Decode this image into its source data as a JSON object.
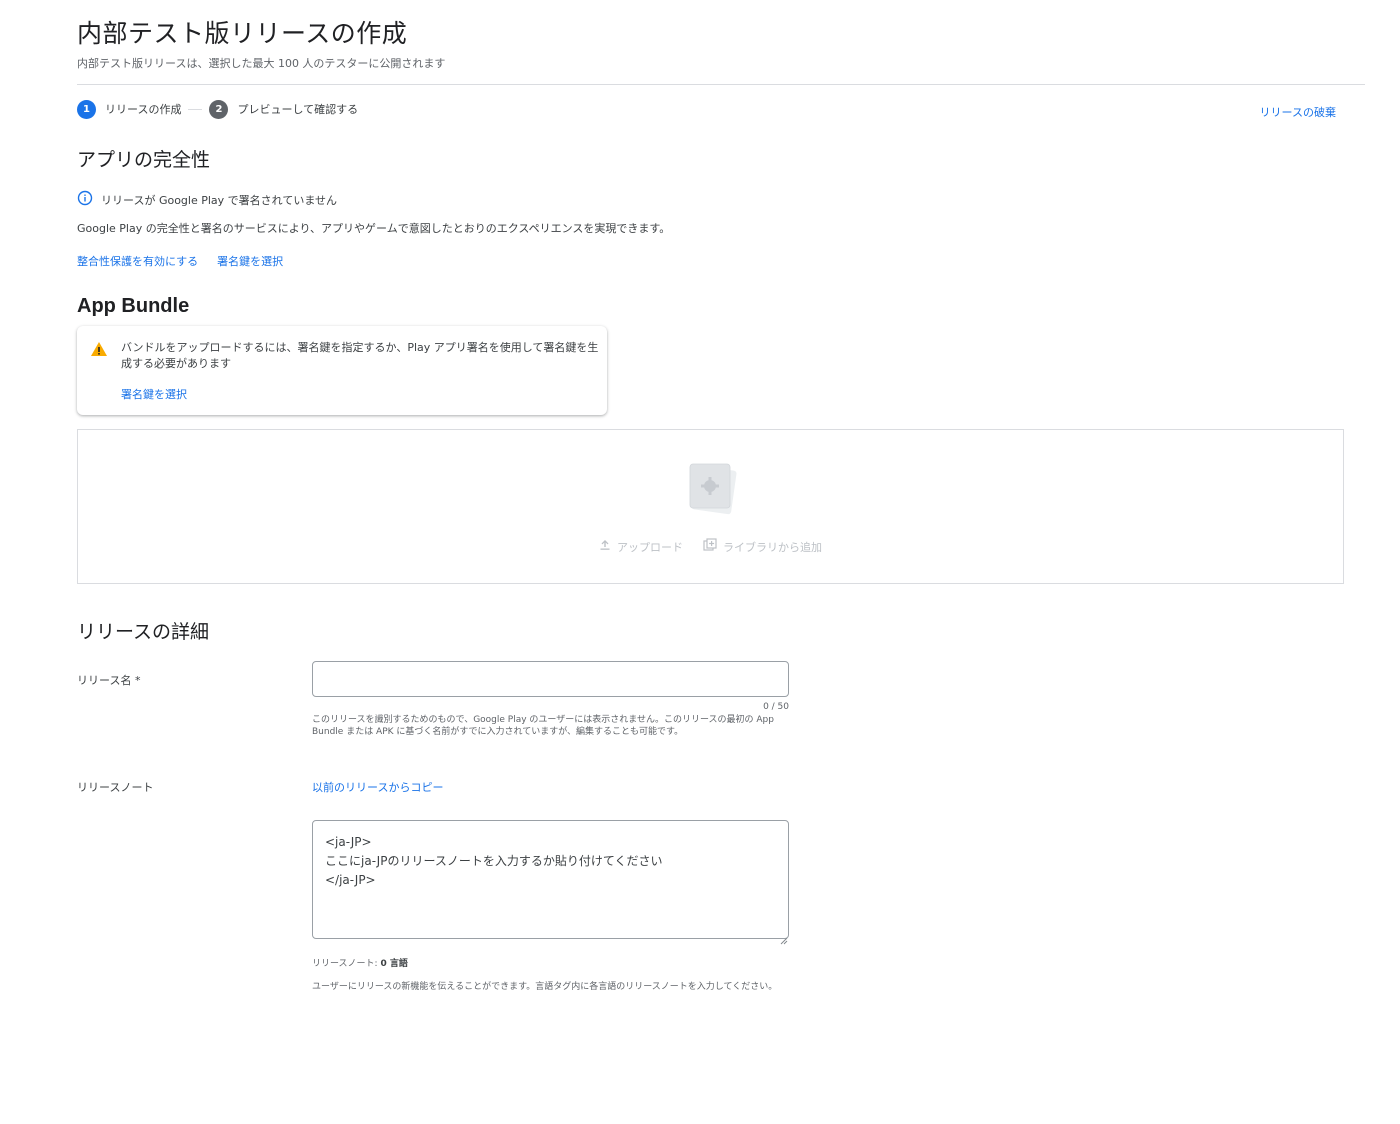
{
  "header": {
    "title": "内部テスト版リリースの作成",
    "subtitle": "内部テスト版リリースは、選択した最大 100 人のテスターに公開されます"
  },
  "stepper": {
    "steps": [
      {
        "number": "1",
        "label": "リリースの作成"
      },
      {
        "number": "2",
        "label": "プレビューして確認する"
      }
    ],
    "discard_label": "リリースの破棄"
  },
  "integrity": {
    "heading": "アプリの完全性",
    "status": "リリースが Google Play で署名されていません",
    "description": "Google Play の完全性と署名のサービスにより、アプリやゲームで意図したとおりのエクスペリエンスを実現できます。",
    "enable_link": "整合性保護を有効にする",
    "select_key_link": "署名鍵を選択"
  },
  "bundle": {
    "heading": "App Bundle",
    "warning": "バンドルをアップロードするには、署名鍵を指定するか、Play アプリ署名を使用して署名鍵を生成する必要があります",
    "warning_link": "署名鍵を選択",
    "upload_label": "アップロード",
    "library_label": "ライブラリから追加"
  },
  "details": {
    "heading": "リリースの詳細",
    "name_label": "リリース名 *",
    "name_value": "",
    "name_counter": "0 / 50",
    "name_helper": "このリリースを識別するためのもので、Google Play のユーザーには表示されません。このリリースの最初の App Bundle または APK に基づく名前がすでに入力されていますが、編集することも可能です。",
    "notes_label": "リリースノート",
    "copy_link": "以前のリリースからコピー",
    "notes_value": "<ja-JP>\nここにja-JPのリリースノートを入力するか貼り付けてください\n</ja-JP>",
    "notes_count_prefix": "リリースノート: ",
    "notes_count_value": "0 言語",
    "notes_help": "ユーザーにリリースの新機能を伝えることができます。言語タグ内に各言語のリリースノートを入力してください。"
  },
  "colors": {
    "accent": "#1a73e8",
    "warning": "#f9ab00",
    "text": "#202124",
    "muted": "#5f6368"
  }
}
